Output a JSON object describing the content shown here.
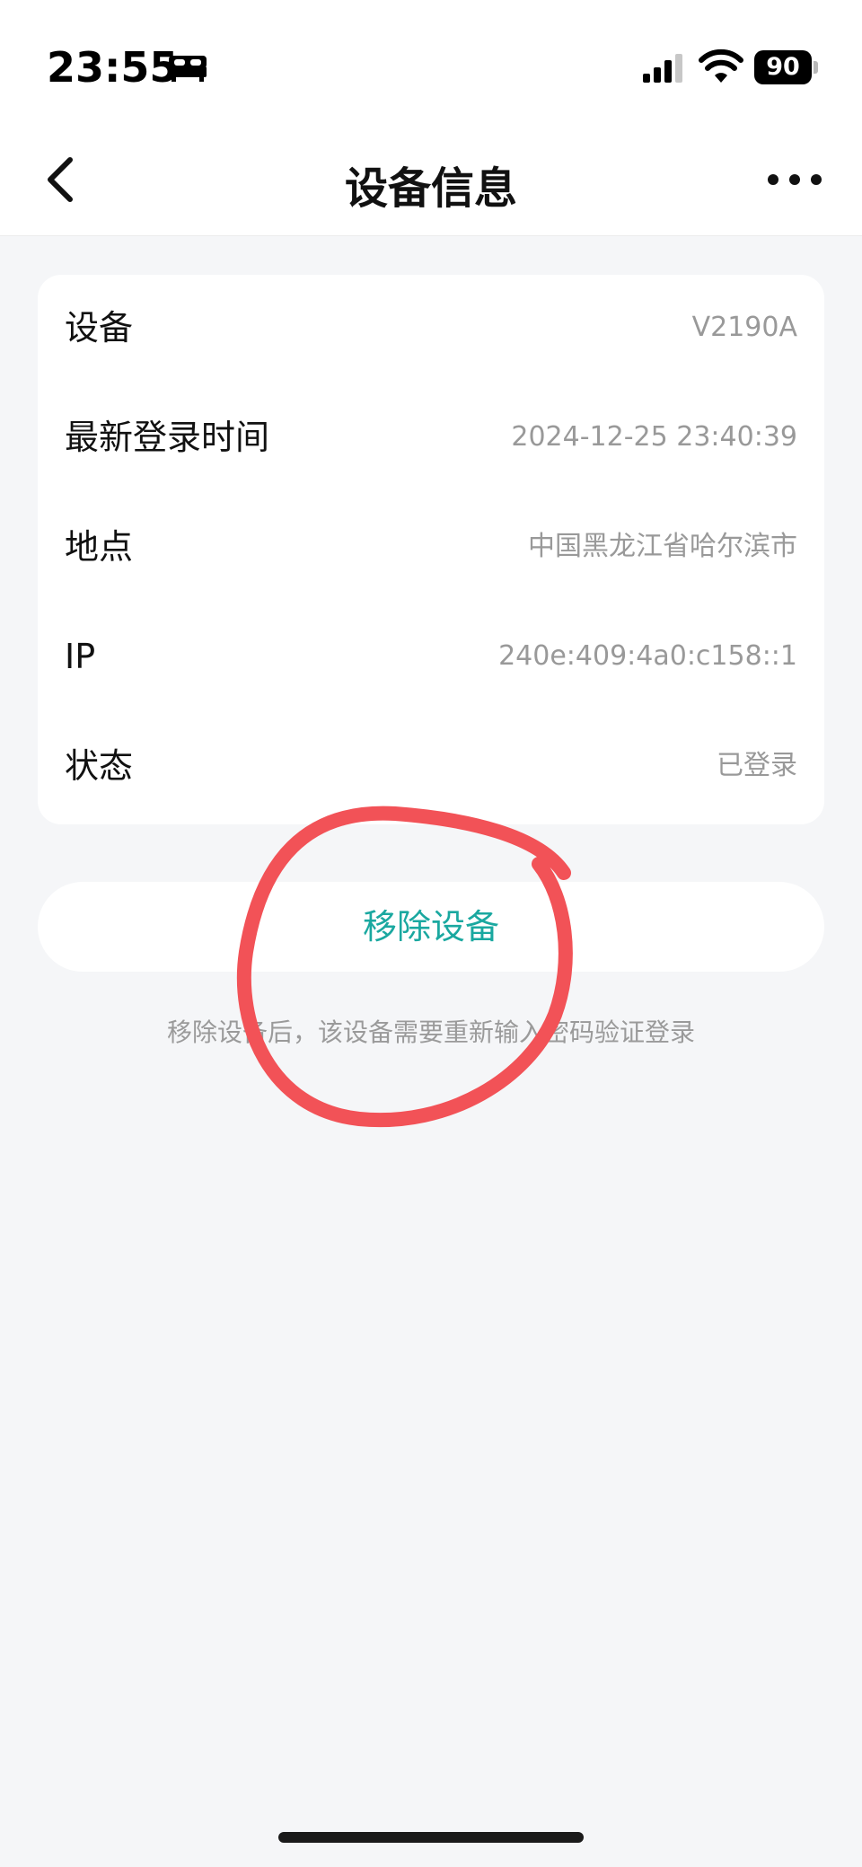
{
  "status_bar": {
    "time": "23:55",
    "battery": "90",
    "focus_icon": "bed-icon",
    "signal_icon": "cellular-signal-icon",
    "wifi_icon": "wifi-icon"
  },
  "nav": {
    "title": "设备信息",
    "back_icon": "chevron-left-icon",
    "more_icon": "more-dots-icon"
  },
  "device_info": {
    "rows": [
      {
        "label": "设备",
        "value": "V2190A"
      },
      {
        "label": "最新登录时间",
        "value": "2024-12-25 23:40:39"
      },
      {
        "label": "地点",
        "value": "中国黑龙江省哈尔滨市"
      },
      {
        "label": "IP",
        "value": "240e:409:4a0:c158::1"
      },
      {
        "label": "状态",
        "value": "已登录"
      }
    ]
  },
  "actions": {
    "remove_label": "移除设备",
    "hint": "移除设备后，该设备需要重新输入密码验证登录"
  },
  "colors": {
    "accent": "#1aa8a0",
    "annotation": "#f25257",
    "background": "#f5f6f8"
  }
}
